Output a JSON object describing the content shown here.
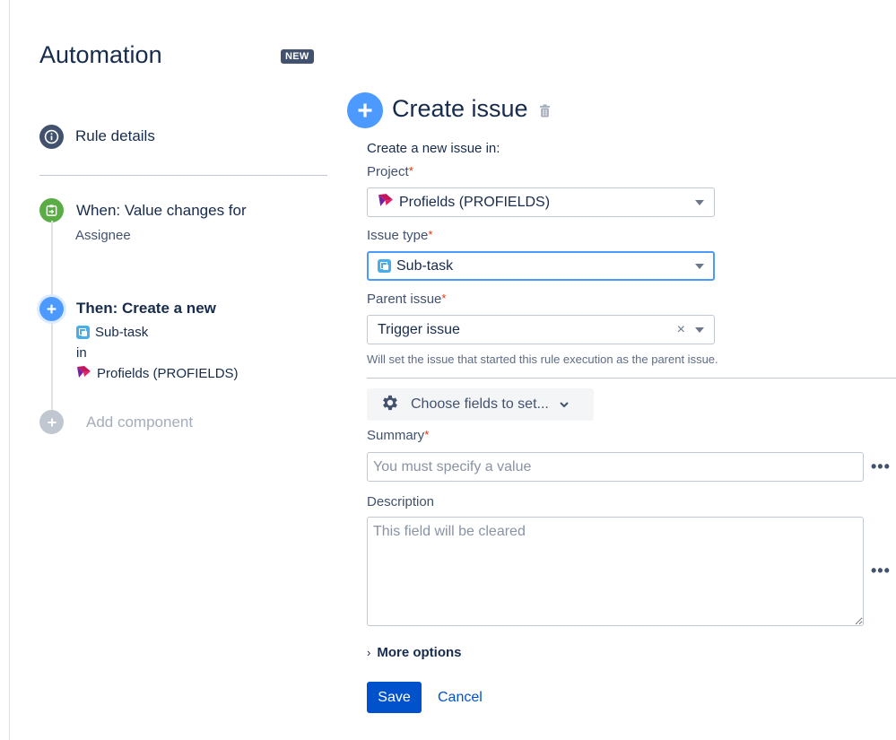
{
  "header": {
    "title": "Automation",
    "badge": "NEW"
  },
  "rail": {
    "rule_details": "Rule details",
    "trigger": {
      "title": "When: Value changes for",
      "field": "Assignee"
    },
    "action": {
      "title": "Then: Create a new",
      "issue_type": "Sub-task",
      "preposition": "in",
      "project": "Profields (PROFIELDS)"
    },
    "add_component": "Add component"
  },
  "form": {
    "title": "Create issue",
    "intro": "Create a new issue in:",
    "project": {
      "label": "Project",
      "required_mark": "*",
      "value": "Profields (PROFIELDS)"
    },
    "issue_type": {
      "label": "Issue type",
      "required_mark": "*",
      "value": "Sub-task"
    },
    "parent_issue": {
      "label": "Parent issue",
      "required_mark": "*",
      "value": "Trigger issue",
      "clear": "×",
      "helper": "Will set the issue that started this rule execution as the parent issue."
    },
    "choose_fields": "Choose fields to set...",
    "summary": {
      "label": "Summary",
      "required_mark": "*",
      "placeholder": "You must specify a value"
    },
    "description": {
      "label": "Description",
      "placeholder": "This field will be cleared"
    },
    "more_dots": "•••",
    "more_options": "More options",
    "more_options_chevron": "›",
    "save": "Save",
    "cancel": "Cancel"
  },
  "colors": {
    "primary": "#0052cc",
    "trigger_green": "#5aac44",
    "action_blue": "#4c9aff",
    "neutral_dark": "#42526e",
    "required_red": "#de350b",
    "subtask_icon": "#4bade8"
  }
}
